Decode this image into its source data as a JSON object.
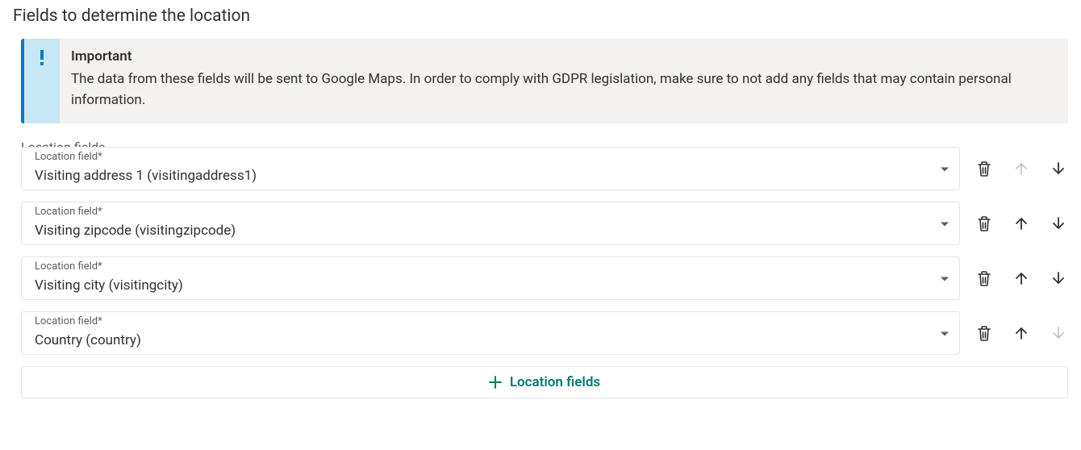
{
  "section": {
    "title": "Fields to determine the location"
  },
  "alert": {
    "title": "Important",
    "text": "The data from these fields will be sent to Google Maps. In order to comply with GDPR legislation, make sure to not add any fields that may contain personal information."
  },
  "fieldset": {
    "label": "Location fields",
    "field_label": "Location field*",
    "rows": [
      {
        "value": "Visiting address 1 (visitingaddress1)",
        "up_enabled": false,
        "down_enabled": true
      },
      {
        "value": "Visiting zipcode (visitingzipcode)",
        "up_enabled": true,
        "down_enabled": true
      },
      {
        "value": "Visiting city (visitingcity)",
        "up_enabled": true,
        "down_enabled": true
      },
      {
        "value": "Country (country)",
        "up_enabled": true,
        "down_enabled": false
      }
    ]
  },
  "add_button": {
    "label": "Location fields"
  }
}
